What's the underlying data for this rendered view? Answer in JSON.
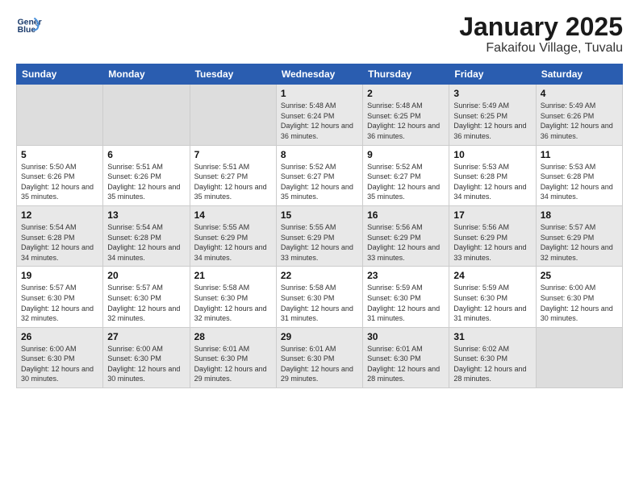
{
  "header": {
    "logo_line1": "General",
    "logo_line2": "Blue",
    "title": "January 2025",
    "subtitle": "Fakaifou Village, Tuvalu"
  },
  "days_of_week": [
    "Sunday",
    "Monday",
    "Tuesday",
    "Wednesday",
    "Thursday",
    "Friday",
    "Saturday"
  ],
  "weeks": [
    [
      {
        "day": "",
        "empty": true
      },
      {
        "day": "",
        "empty": true
      },
      {
        "day": "",
        "empty": true
      },
      {
        "day": "1",
        "sunrise": "5:48 AM",
        "sunset": "6:24 PM",
        "daylight": "12 hours and 36 minutes."
      },
      {
        "day": "2",
        "sunrise": "5:48 AM",
        "sunset": "6:25 PM",
        "daylight": "12 hours and 36 minutes."
      },
      {
        "day": "3",
        "sunrise": "5:49 AM",
        "sunset": "6:25 PM",
        "daylight": "12 hours and 36 minutes."
      },
      {
        "day": "4",
        "sunrise": "5:49 AM",
        "sunset": "6:26 PM",
        "daylight": "12 hours and 36 minutes."
      }
    ],
    [
      {
        "day": "5",
        "sunrise": "5:50 AM",
        "sunset": "6:26 PM",
        "daylight": "12 hours and 35 minutes."
      },
      {
        "day": "6",
        "sunrise": "5:51 AM",
        "sunset": "6:26 PM",
        "daylight": "12 hours and 35 minutes."
      },
      {
        "day": "7",
        "sunrise": "5:51 AM",
        "sunset": "6:27 PM",
        "daylight": "12 hours and 35 minutes."
      },
      {
        "day": "8",
        "sunrise": "5:52 AM",
        "sunset": "6:27 PM",
        "daylight": "12 hours and 35 minutes."
      },
      {
        "day": "9",
        "sunrise": "5:52 AM",
        "sunset": "6:27 PM",
        "daylight": "12 hours and 35 minutes."
      },
      {
        "day": "10",
        "sunrise": "5:53 AM",
        "sunset": "6:28 PM",
        "daylight": "12 hours and 34 minutes."
      },
      {
        "day": "11",
        "sunrise": "5:53 AM",
        "sunset": "6:28 PM",
        "daylight": "12 hours and 34 minutes."
      }
    ],
    [
      {
        "day": "12",
        "sunrise": "5:54 AM",
        "sunset": "6:28 PM",
        "daylight": "12 hours and 34 minutes."
      },
      {
        "day": "13",
        "sunrise": "5:54 AM",
        "sunset": "6:28 PM",
        "daylight": "12 hours and 34 minutes."
      },
      {
        "day": "14",
        "sunrise": "5:55 AM",
        "sunset": "6:29 PM",
        "daylight": "12 hours and 34 minutes."
      },
      {
        "day": "15",
        "sunrise": "5:55 AM",
        "sunset": "6:29 PM",
        "daylight": "12 hours and 33 minutes."
      },
      {
        "day": "16",
        "sunrise": "5:56 AM",
        "sunset": "6:29 PM",
        "daylight": "12 hours and 33 minutes."
      },
      {
        "day": "17",
        "sunrise": "5:56 AM",
        "sunset": "6:29 PM",
        "daylight": "12 hours and 33 minutes."
      },
      {
        "day": "18",
        "sunrise": "5:57 AM",
        "sunset": "6:29 PM",
        "daylight": "12 hours and 32 minutes."
      }
    ],
    [
      {
        "day": "19",
        "sunrise": "5:57 AM",
        "sunset": "6:30 PM",
        "daylight": "12 hours and 32 minutes."
      },
      {
        "day": "20",
        "sunrise": "5:57 AM",
        "sunset": "6:30 PM",
        "daylight": "12 hours and 32 minutes."
      },
      {
        "day": "21",
        "sunrise": "5:58 AM",
        "sunset": "6:30 PM",
        "daylight": "12 hours and 32 minutes."
      },
      {
        "day": "22",
        "sunrise": "5:58 AM",
        "sunset": "6:30 PM",
        "daylight": "12 hours and 31 minutes."
      },
      {
        "day": "23",
        "sunrise": "5:59 AM",
        "sunset": "6:30 PM",
        "daylight": "12 hours and 31 minutes."
      },
      {
        "day": "24",
        "sunrise": "5:59 AM",
        "sunset": "6:30 PM",
        "daylight": "12 hours and 31 minutes."
      },
      {
        "day": "25",
        "sunrise": "6:00 AM",
        "sunset": "6:30 PM",
        "daylight": "12 hours and 30 minutes."
      }
    ],
    [
      {
        "day": "26",
        "sunrise": "6:00 AM",
        "sunset": "6:30 PM",
        "daylight": "12 hours and 30 minutes."
      },
      {
        "day": "27",
        "sunrise": "6:00 AM",
        "sunset": "6:30 PM",
        "daylight": "12 hours and 30 minutes."
      },
      {
        "day": "28",
        "sunrise": "6:01 AM",
        "sunset": "6:30 PM",
        "daylight": "12 hours and 29 minutes."
      },
      {
        "day": "29",
        "sunrise": "6:01 AM",
        "sunset": "6:30 PM",
        "daylight": "12 hours and 29 minutes."
      },
      {
        "day": "30",
        "sunrise": "6:01 AM",
        "sunset": "6:30 PM",
        "daylight": "12 hours and 28 minutes."
      },
      {
        "day": "31",
        "sunrise": "6:02 AM",
        "sunset": "6:30 PM",
        "daylight": "12 hours and 28 minutes."
      },
      {
        "day": "",
        "empty": true
      }
    ]
  ],
  "labels": {
    "sunrise": "Sunrise:",
    "sunset": "Sunset:",
    "daylight": "Daylight:"
  }
}
